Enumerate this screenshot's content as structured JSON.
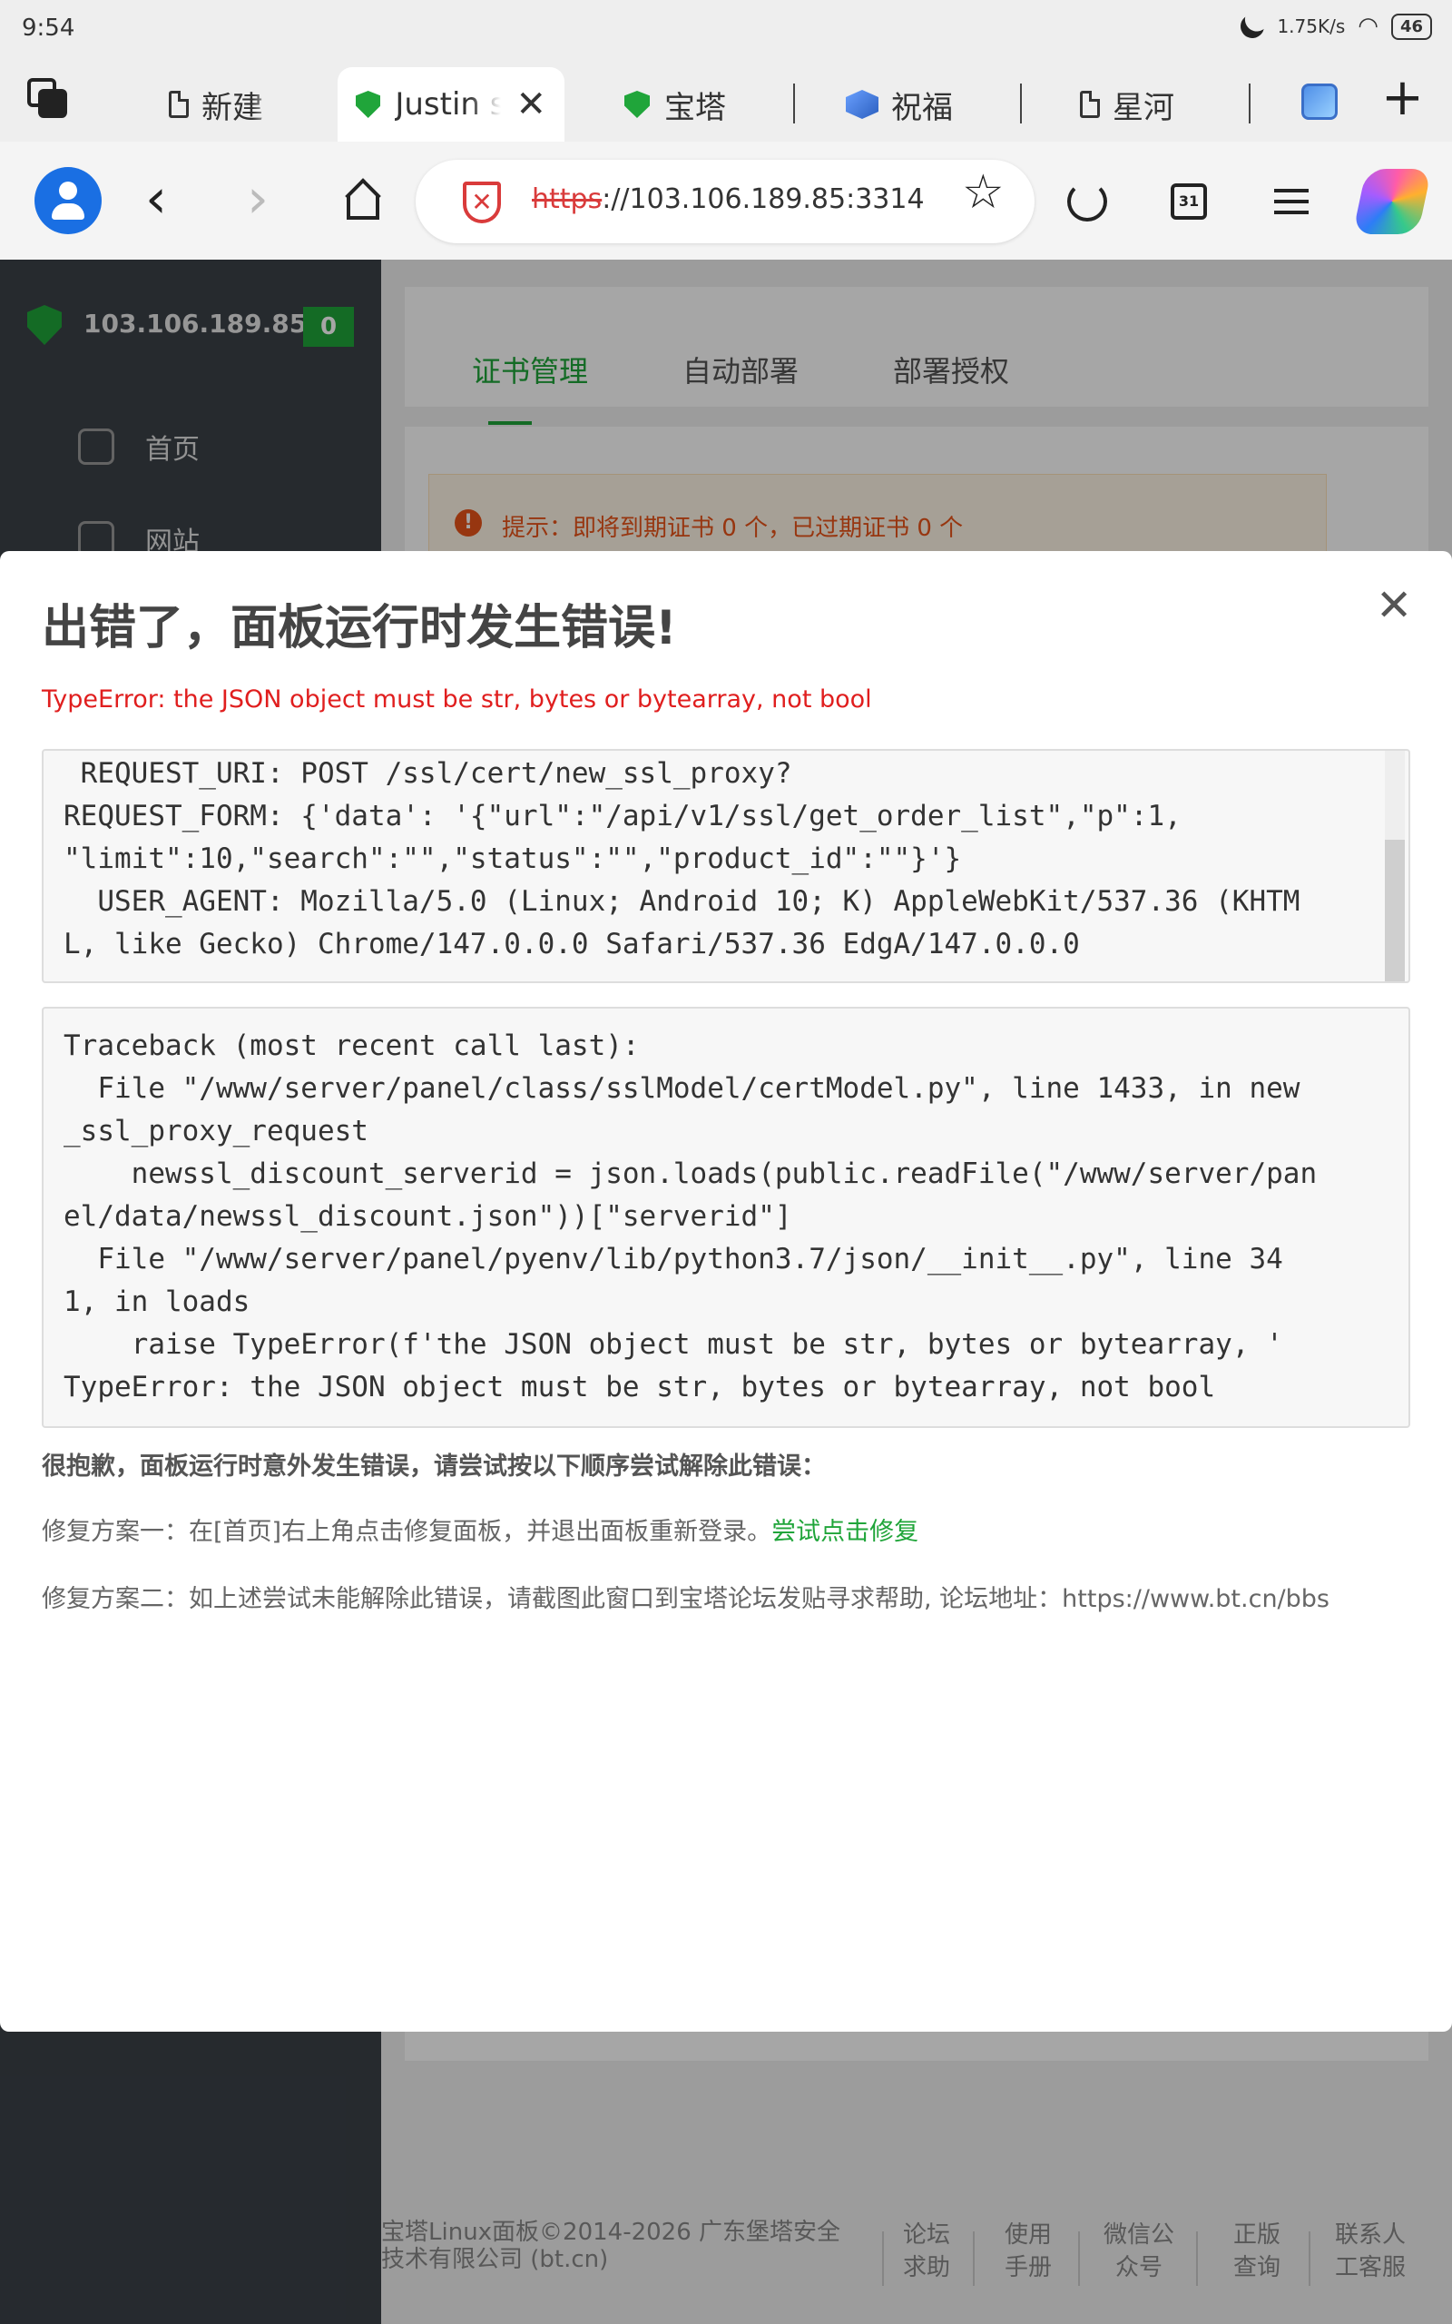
{
  "status_bar": {
    "time": "9:54",
    "network_speed": "1.75K/s",
    "battery": "46"
  },
  "tabs": [
    {
      "label": "新建",
      "icon": "document-icon",
      "active": false
    },
    {
      "label": "Justin s",
      "icon": "baota-shield-icon",
      "active": true
    },
    {
      "label": "宝塔",
      "icon": "baota-shield-icon",
      "active": false
    },
    {
      "label": "祝福",
      "icon": "cube-icon",
      "active": false
    },
    {
      "label": "星河",
      "icon": "document-icon",
      "active": false
    }
  ],
  "toolbar": {
    "url_scheme": "https",
    "url_rest": "://103.106.189.85:3314",
    "calendar_day": "31"
  },
  "sidebar": {
    "server_ip": "103.106.189.85",
    "badge": "0",
    "items": [
      {
        "label": "首页"
      },
      {
        "label": "网站"
      }
    ]
  },
  "main": {
    "tabs": [
      "证书管理",
      "自动部署",
      "部署授权"
    ],
    "tip": "提示：即将到期证书 0 个，已过期证书 0 个",
    "footer_copyright": "宝塔Linux面板©2014-2026 广东堡塔安全技术有限公司 (bt.cn)",
    "footer_links": [
      "论坛求助",
      "使用手册",
      "微信公众号",
      "正版查询",
      "联系人工客服"
    ]
  },
  "dialog": {
    "title": "出错了，面板运行时发生错误!",
    "error_line": "TypeError: the JSON object must be str, bytes or bytearray, not bool",
    "request_info": " REQUEST_URI: POST /ssl/cert/new_ssl_proxy?\nREQUEST_FORM: {'data': '{\"url\":\"/api/v1/ssl/get_order_list\",\"p\":1,\n\"limit\":10,\"search\":\"\",\"status\":\"\",\"product_id\":\"\"}'}\n  USER_AGENT: Mozilla/5.0 (Linux; Android 10; K) AppleWebKit/537.36 (KHTM\nL, like Gecko) Chrome/147.0.0.0 Safari/537.36 EdgA/147.0.0.0",
    "traceback": "Traceback (most recent call last):\n  File \"/www/server/panel/class/sslModel/certModel.py\", line 1433, in new\n_ssl_proxy_request\n    newssl_discount_serverid = json.loads(public.readFile(\"/www/server/pan\nel/data/newssl_discount.json\"))[\"serverid\"]\n  File \"/www/server/panel/pyenv/lib/python3.7/json/__init__.py\", line 34\n1, in loads\n    raise TypeError(f'the JSON object must be str, bytes or bytearray, '\nTypeError: the JSON object must be str, bytes or bytearray, not bool",
    "sorry": "很抱歉，面板运行时意外发生错误，请尝试按以下顺序尝试解除此错误：",
    "fix1_text": "修复方案一：在[首页]右上角点击修复面板，并退出面板重新登录。",
    "fix1_link": "尝试点击修复",
    "fix2_text": "修复方案二：如上述尝试未能解除此错误，请截图此窗口到宝塔论坛发贴寻求帮助, 论坛地址：https://www.bt.cn/bbs"
  },
  "colors": {
    "accent": "#20a53a",
    "error": "#e01e1e",
    "sidebar": "#3b4148"
  }
}
